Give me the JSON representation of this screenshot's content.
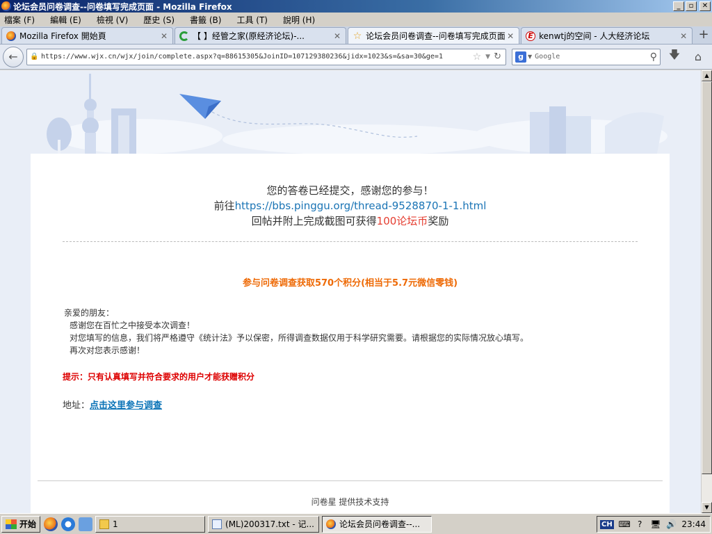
{
  "window": {
    "title": "论坛会员问卷调查--问卷填写完成页面 - Mozilla Firefox",
    "controls": {
      "minimize": "_",
      "maximize": "▫",
      "close": "✕"
    }
  },
  "menu": [
    "檔案 (F)",
    "編輯 (E)",
    "檢視 (V)",
    "歷史 (S)",
    "書籤 (B)",
    "工具 (T)",
    "說明 (H)"
  ],
  "tabs": [
    {
      "label": "Mozilla Firefox 開始頁",
      "icon": "firefox-icon",
      "active": false
    },
    {
      "label": "【          】经管之家(原经济论坛)-...",
      "icon": "loading-icon",
      "active": false
    },
    {
      "label": "论坛会员问卷调查--问卷填写完成页面",
      "icon": "star-icon",
      "active": true
    },
    {
      "label": "kenwtj的空间 - 人大经济论坛",
      "icon": "e-icon",
      "active": false
    }
  ],
  "nav": {
    "url": "https://www.wjx.cn/wjx/join/complete.aspx?q=8861530​5&JoinID=107129380236&jidx=1023&s=&sa=30&ge=1",
    "search_placeholder": "Google",
    "search_engine_letter": "g"
  },
  "content": {
    "complete_line1": "您的答卷已经提交，感谢您的参与！",
    "complete_line2_prefix": "前往",
    "complete_line2_link": "https://bbs.pinggu.org/thread-9528870-1-1.html",
    "complete_line3_prefix": "回帖并附上完成截图可获得",
    "complete_line3_reward": "100论坛币",
    "complete_line3_suffix": "奖励",
    "points_title": "参与问卷调查获取570个积分(相当于5.7元微信零钱)",
    "greeting": "亲爱的朋友：",
    "body_line1": "感谢您在百忙之中接受本次调查！",
    "body_line2": "对您填写的信息，我们将严格遵守《统计法》予以保密，所得调查数据仅用于科学研究需要。请根据您的实际情况放心填写。",
    "body_line3": "再次对您表示感谢！",
    "tip": "提示：只有认真填写并符合要求的用户才能获赠积分",
    "address_label": "地址：",
    "address_link": "点击这里参与调查",
    "footer": "问卷星 提供技术支持"
  },
  "taskbar": {
    "start_label": "开始",
    "tasks": [
      {
        "label": "1",
        "icon": "folder",
        "pressed": false
      },
      {
        "label": "(ML)200317.txt - 记...",
        "icon": "notepad",
        "pressed": false
      },
      {
        "label": "论坛会员问卷调查--...",
        "icon": "firefox",
        "pressed": true
      }
    ],
    "ime": "CH",
    "clock": "23:44"
  }
}
